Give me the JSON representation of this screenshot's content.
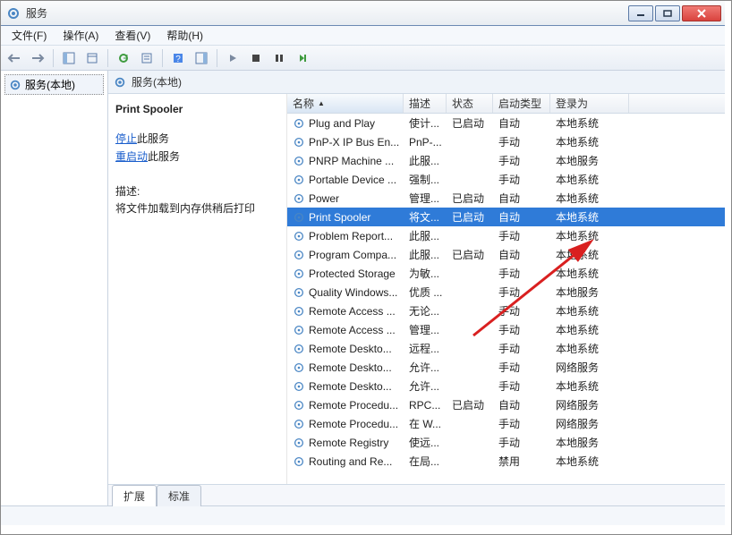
{
  "window": {
    "title": "服务"
  },
  "menubar": [
    "文件(F)",
    "操作(A)",
    "查看(V)",
    "帮助(H)"
  ],
  "tree": {
    "root_label": "服务(本地)"
  },
  "right_header": "服务(本地)",
  "detail": {
    "service_name": "Print Spooler",
    "stop_link": "停止",
    "stop_tail": "此服务",
    "restart_link": "重启动",
    "restart_tail": "此服务",
    "desc_label": "描述:",
    "desc_text": "将文件加载到内存供稍后打印"
  },
  "columns": [
    "名称",
    "描述",
    "状态",
    "启动类型",
    "登录为"
  ],
  "services": [
    {
      "name": "Plug and Play",
      "desc": "使计...",
      "status": "已启动",
      "start": "自动",
      "logon": "本地系统"
    },
    {
      "name": "PnP-X IP Bus En...",
      "desc": "PnP-...",
      "status": "",
      "start": "手动",
      "logon": "本地系统"
    },
    {
      "name": "PNRP Machine ...",
      "desc": "此服...",
      "status": "",
      "start": "手动",
      "logon": "本地服务"
    },
    {
      "name": "Portable Device ...",
      "desc": "强制...",
      "status": "",
      "start": "手动",
      "logon": "本地系统"
    },
    {
      "name": "Power",
      "desc": "管理...",
      "status": "已启动",
      "start": "自动",
      "logon": "本地系统"
    },
    {
      "name": "Print Spooler",
      "desc": "将文...",
      "status": "已启动",
      "start": "自动",
      "logon": "本地系统",
      "selected": true
    },
    {
      "name": "Problem Report...",
      "desc": "此服...",
      "status": "",
      "start": "手动",
      "logon": "本地系统"
    },
    {
      "name": "Program Compa...",
      "desc": "此服...",
      "status": "已启动",
      "start": "自动",
      "logon": "本地系统"
    },
    {
      "name": "Protected Storage",
      "desc": "为敏...",
      "status": "",
      "start": "手动",
      "logon": "本地系统"
    },
    {
      "name": "Quality Windows...",
      "desc": "优质 ...",
      "status": "",
      "start": "手动",
      "logon": "本地服务"
    },
    {
      "name": "Remote Access ...",
      "desc": "无论...",
      "status": "",
      "start": "手动",
      "logon": "本地系统"
    },
    {
      "name": "Remote Access ...",
      "desc": "管理...",
      "status": "",
      "start": "手动",
      "logon": "本地系统"
    },
    {
      "name": "Remote Deskto...",
      "desc": "远程...",
      "status": "",
      "start": "手动",
      "logon": "本地系统"
    },
    {
      "name": "Remote Deskto...",
      "desc": "允许...",
      "status": "",
      "start": "手动",
      "logon": "网络服务"
    },
    {
      "name": "Remote Deskto...",
      "desc": "允许...",
      "status": "",
      "start": "手动",
      "logon": "本地系统"
    },
    {
      "name": "Remote Procedu...",
      "desc": "RPC...",
      "status": "已启动",
      "start": "自动",
      "logon": "网络服务"
    },
    {
      "name": "Remote Procedu...",
      "desc": "在 W...",
      "status": "",
      "start": "手动",
      "logon": "网络服务"
    },
    {
      "name": "Remote Registry",
      "desc": "使远...",
      "status": "",
      "start": "手动",
      "logon": "本地服务"
    },
    {
      "name": "Routing and Re...",
      "desc": "在局...",
      "status": "",
      "start": "禁用",
      "logon": "本地系统"
    }
  ],
  "tabs": {
    "extended": "扩展",
    "standard": "标准"
  }
}
